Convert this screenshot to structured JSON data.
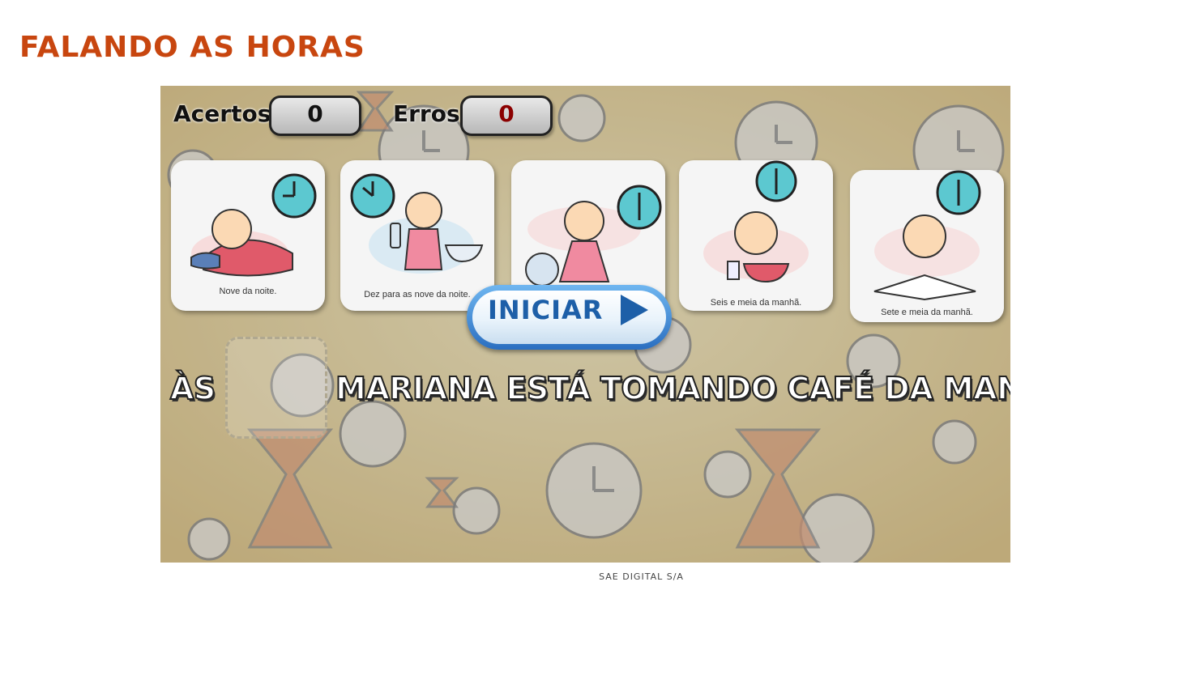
{
  "page": {
    "title": "FALANDO AS HORAS",
    "footer": "SAE DIGITAL S/A"
  },
  "score": {
    "hits_label": "Acertos",
    "hits_value": "0",
    "errors_label": "Erros",
    "errors_value": "0"
  },
  "cards": [
    {
      "caption": "Nove da noite."
    },
    {
      "caption": "Dez para as nove da noite."
    },
    {
      "caption": ""
    },
    {
      "caption": "Seis e meia da manhã."
    },
    {
      "caption": "Sete e meia da manhã."
    }
  ],
  "sentence": {
    "prefix": "ÀS",
    "text": "MARIANA ESTÁ TOMANDO CAFÉ DA MANHÃ."
  },
  "start_button": {
    "label": "INICIAR"
  },
  "colors": {
    "title": "#c8460f",
    "errors_value": "#8b0000",
    "start_button": "#1d5fa8",
    "clock_face": "#5cc8d0",
    "background": "#f0dc9a"
  }
}
